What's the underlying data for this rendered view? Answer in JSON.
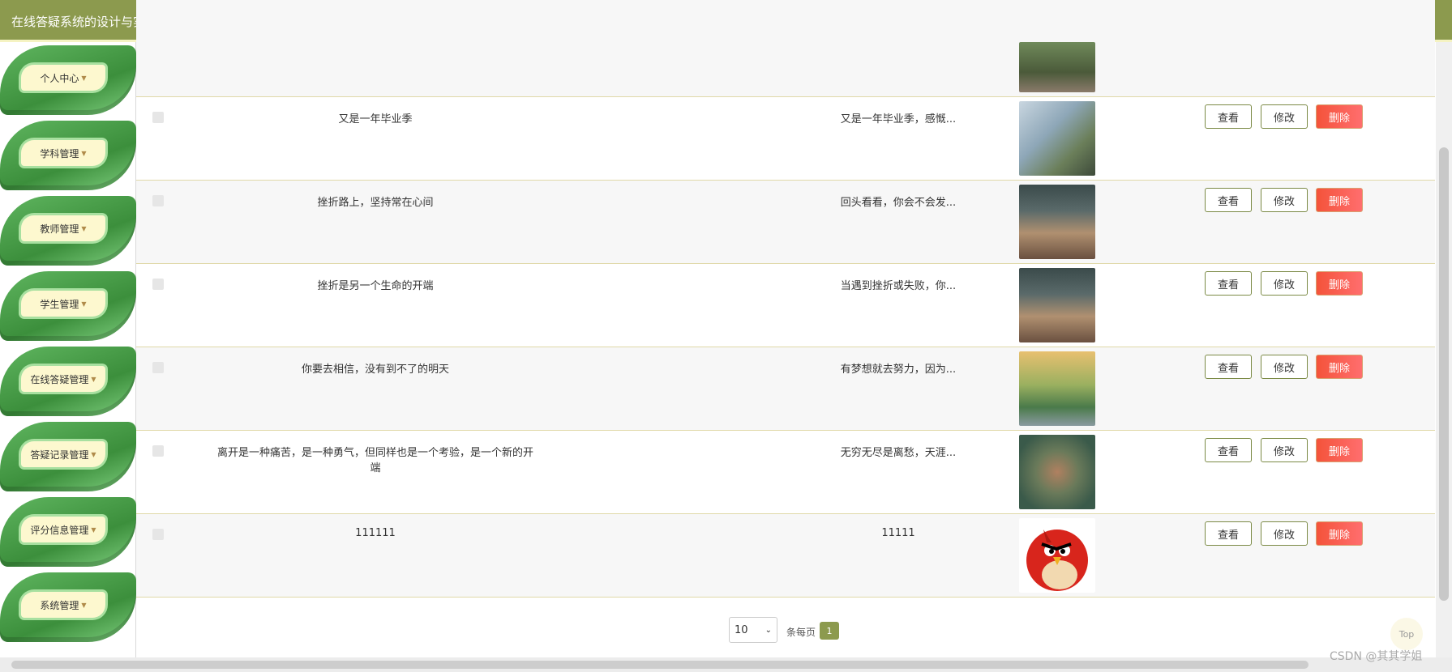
{
  "header": {
    "title": "在线答疑系统的设计与实现"
  },
  "sidebar": {
    "items": [
      {
        "label": "个人中心"
      },
      {
        "label": "学科管理"
      },
      {
        "label": "教师管理"
      },
      {
        "label": "学生管理"
      },
      {
        "label": "在线答疑管理"
      },
      {
        "label": "答疑记录管理"
      },
      {
        "label": "评分信息管理"
      },
      {
        "label": "系统管理"
      }
    ],
    "caret": "▼"
  },
  "actions": {
    "view": "查看",
    "edit": "修改",
    "delete": "删除"
  },
  "rows": [
    {
      "title": "又是一年毕业季",
      "content": "又是一年毕业季，感慨..."
    },
    {
      "title": "挫折路上，坚持常在心间",
      "content": "回头看看，你会不会发..."
    },
    {
      "title": "挫折是另一个生命的开端",
      "content": "当遇到挫折或失败，你..."
    },
    {
      "title": "你要去相信，没有到不了的明天",
      "content": "有梦想就去努力，因为..."
    },
    {
      "title": "离开是一种痛苦，是一种勇气，但同样也是一个考验，是一个新的开端",
      "content": "无穷无尽是离愁，天涯..."
    },
    {
      "title": "111111",
      "content": "11111"
    }
  ],
  "pagination": {
    "page_size": "10",
    "per_page_label": "条每页",
    "current_page": "1"
  },
  "top_label": "Top",
  "watermark": "CSDN @其其学姐"
}
